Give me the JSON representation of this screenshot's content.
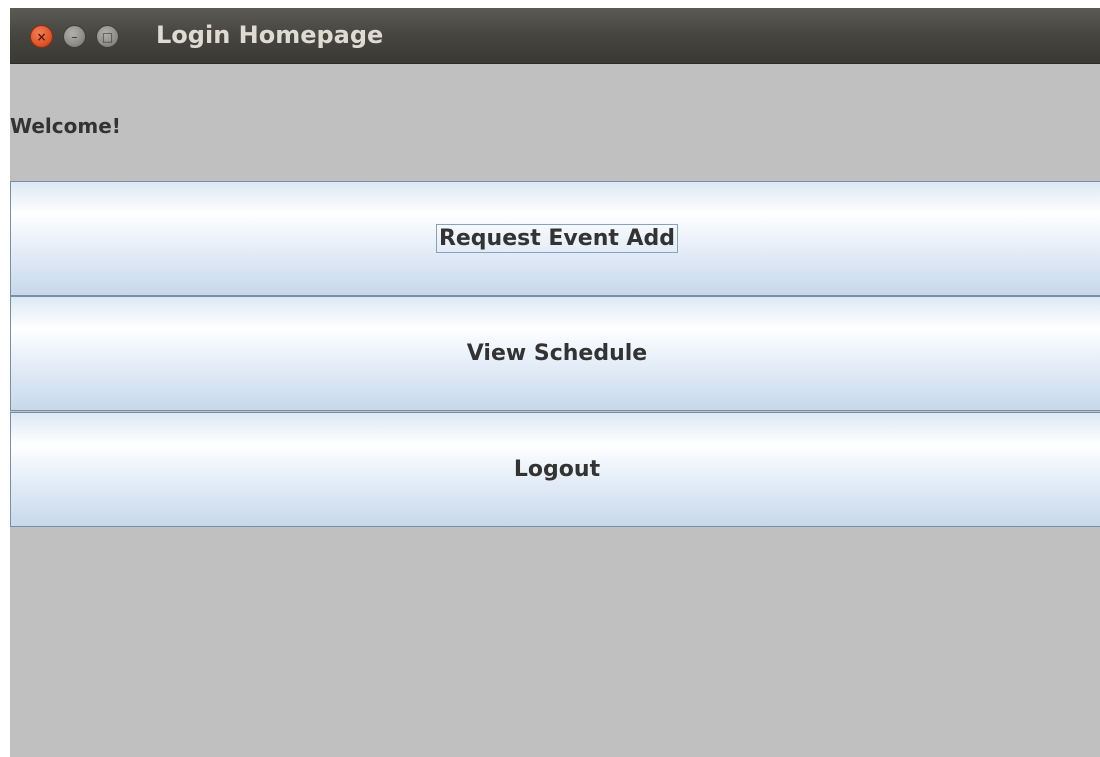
{
  "window": {
    "title": "Login Homepage",
    "controls": {
      "close_icon": "close-icon",
      "close_glyph": "×",
      "minimize_icon": "minimize-icon",
      "minimize_glyph": "–",
      "maximize_icon": "maximize-icon",
      "maximize_glyph": "□"
    }
  },
  "main": {
    "welcome_text": "Welcome!",
    "buttons": [
      {
        "label": "Request Event Add",
        "focused": true
      },
      {
        "label": "View Schedule",
        "focused": false
      },
      {
        "label": "Logout",
        "focused": false
      }
    ]
  },
  "colors": {
    "titlebar": "#46453f",
    "close_button": "#e15a2f",
    "window_background": "#c0c0c0",
    "button_border": "#7a8ea8",
    "button_gradient_light": "#ffffff",
    "button_gradient_dark": "#c7d8ea",
    "text": "#333333"
  }
}
